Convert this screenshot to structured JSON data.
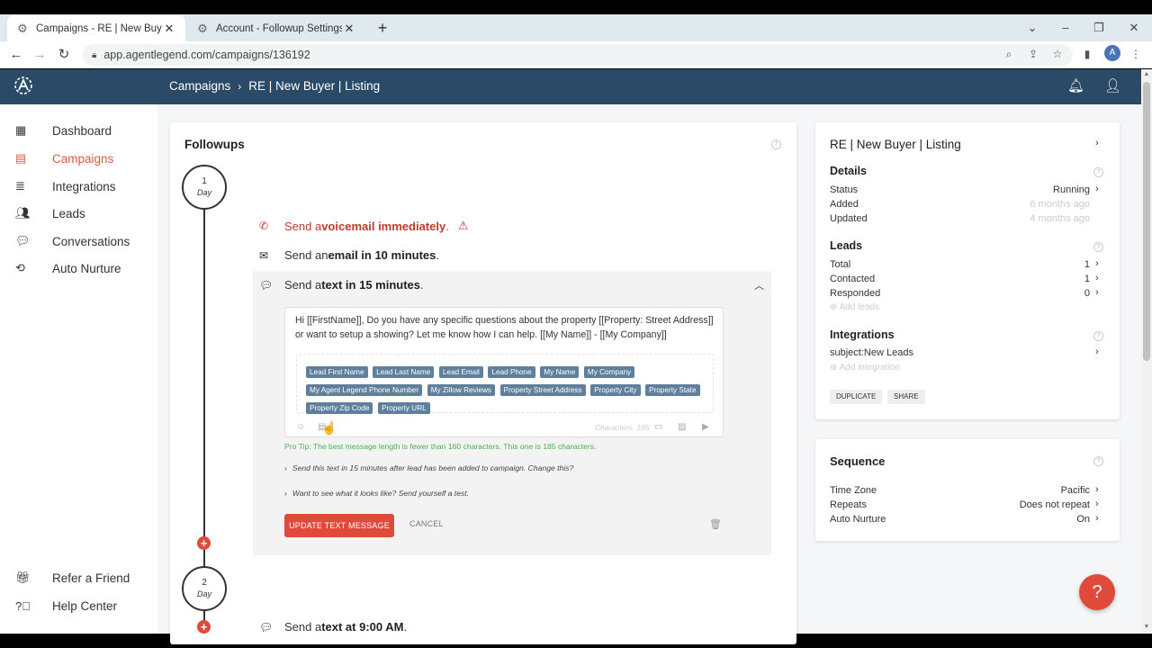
{
  "browser": {
    "tabs": [
      {
        "title": "Campaigns - RE | New Buyer | Listing",
        "active": true
      },
      {
        "title": "Account - Followup Settings",
        "active": false
      }
    ],
    "url": "app.agentlegend.com/campaigns/136192",
    "profile_initial": "A"
  },
  "header": {
    "breadcrumb_root": "Campaigns",
    "breadcrumb_current": "RE | New Buyer | Listing"
  },
  "sidebar": {
    "items": [
      {
        "label": "Dashboard",
        "icon": "dashboard-icon"
      },
      {
        "label": "Campaigns",
        "icon": "calendar-icon",
        "active": true
      },
      {
        "label": "Integrations",
        "icon": "stack-icon"
      },
      {
        "label": "Leads",
        "icon": "users-icon"
      },
      {
        "label": "Conversations",
        "icon": "chat-icon"
      },
      {
        "label": "Auto Nurture",
        "icon": "repeat-icon"
      }
    ],
    "bottom": [
      {
        "label": "Refer a Friend",
        "icon": "gift-icon"
      },
      {
        "label": "Help Center",
        "icon": "help-icon"
      }
    ]
  },
  "followups": {
    "title": "Followups",
    "day1": {
      "number": "1",
      "unit": "Day"
    },
    "day2": {
      "number": "2",
      "unit": "Day"
    },
    "steps": [
      {
        "pre": "Send a ",
        "bold": "voicemail immediately",
        "post": "."
      },
      {
        "pre": "Send an ",
        "bold": "email in 10 minutes",
        "post": "."
      },
      {
        "pre": "Send a ",
        "bold": "text in 15 minutes",
        "post": "."
      }
    ],
    "day2_step": {
      "pre": "Send a ",
      "bold": "text at 9:00 AM",
      "post": "."
    },
    "message": "Hi [[FirstName]], Do you have any specific questions about the property [[Property: Street Address]] or want to setup a showing? Let me know how I can help. [[My Name]] - [[My Company]]",
    "tags": [
      "Lead First Name",
      "Lead Last Name",
      "Lead Email",
      "Lead Phone",
      "My Name",
      "My Company",
      "My Agent Legend Phone Number",
      "My Zillow Reviews",
      "Property Street Address",
      "Property City",
      "Property State",
      "Property Zip Code",
      "Property URL"
    ],
    "char_count": "Characters: 185",
    "pro_tip": "Pro Tip: The best message length is fewer than 160 characters. This one is 185 characters.",
    "timing_note": "Send this text in 15 minutes after lead has been added to campaign. Change this?",
    "test_note": "Want to see what it looks like? Send yourself a test.",
    "update_label": "UPDATE TEXT MESSAGE",
    "cancel_label": "CANCEL"
  },
  "campaign": {
    "title": "RE | New Buyer | Listing",
    "details_heading": "Details",
    "details": [
      {
        "label": "Status",
        "value": "Running"
      },
      {
        "label": "Added",
        "value": "6 months ago"
      },
      {
        "label": "Updated",
        "value": "4 months ago"
      }
    ],
    "leads_heading": "Leads",
    "leads": [
      {
        "label": "Total",
        "value": "1"
      },
      {
        "label": "Contacted",
        "value": "1"
      },
      {
        "label": "Responded",
        "value": "0"
      }
    ],
    "add_leads": "Add leads",
    "integrations_heading": "Integrations",
    "integration_item": "subject:New Leads",
    "add_integration": "Add integration",
    "duplicate_label": "DUPLICATE",
    "share_label": "SHARE"
  },
  "sequence": {
    "heading": "Sequence",
    "rows": [
      {
        "label": "Time Zone",
        "value": "Pacific"
      },
      {
        "label": "Repeats",
        "value": "Does not repeat"
      },
      {
        "label": "Auto Nurture",
        "value": "On"
      }
    ]
  },
  "colors": {
    "accent": "#e04a3a",
    "header": "#2a4a67",
    "tag": "#5f7f9c",
    "protip": "#4caf50"
  }
}
